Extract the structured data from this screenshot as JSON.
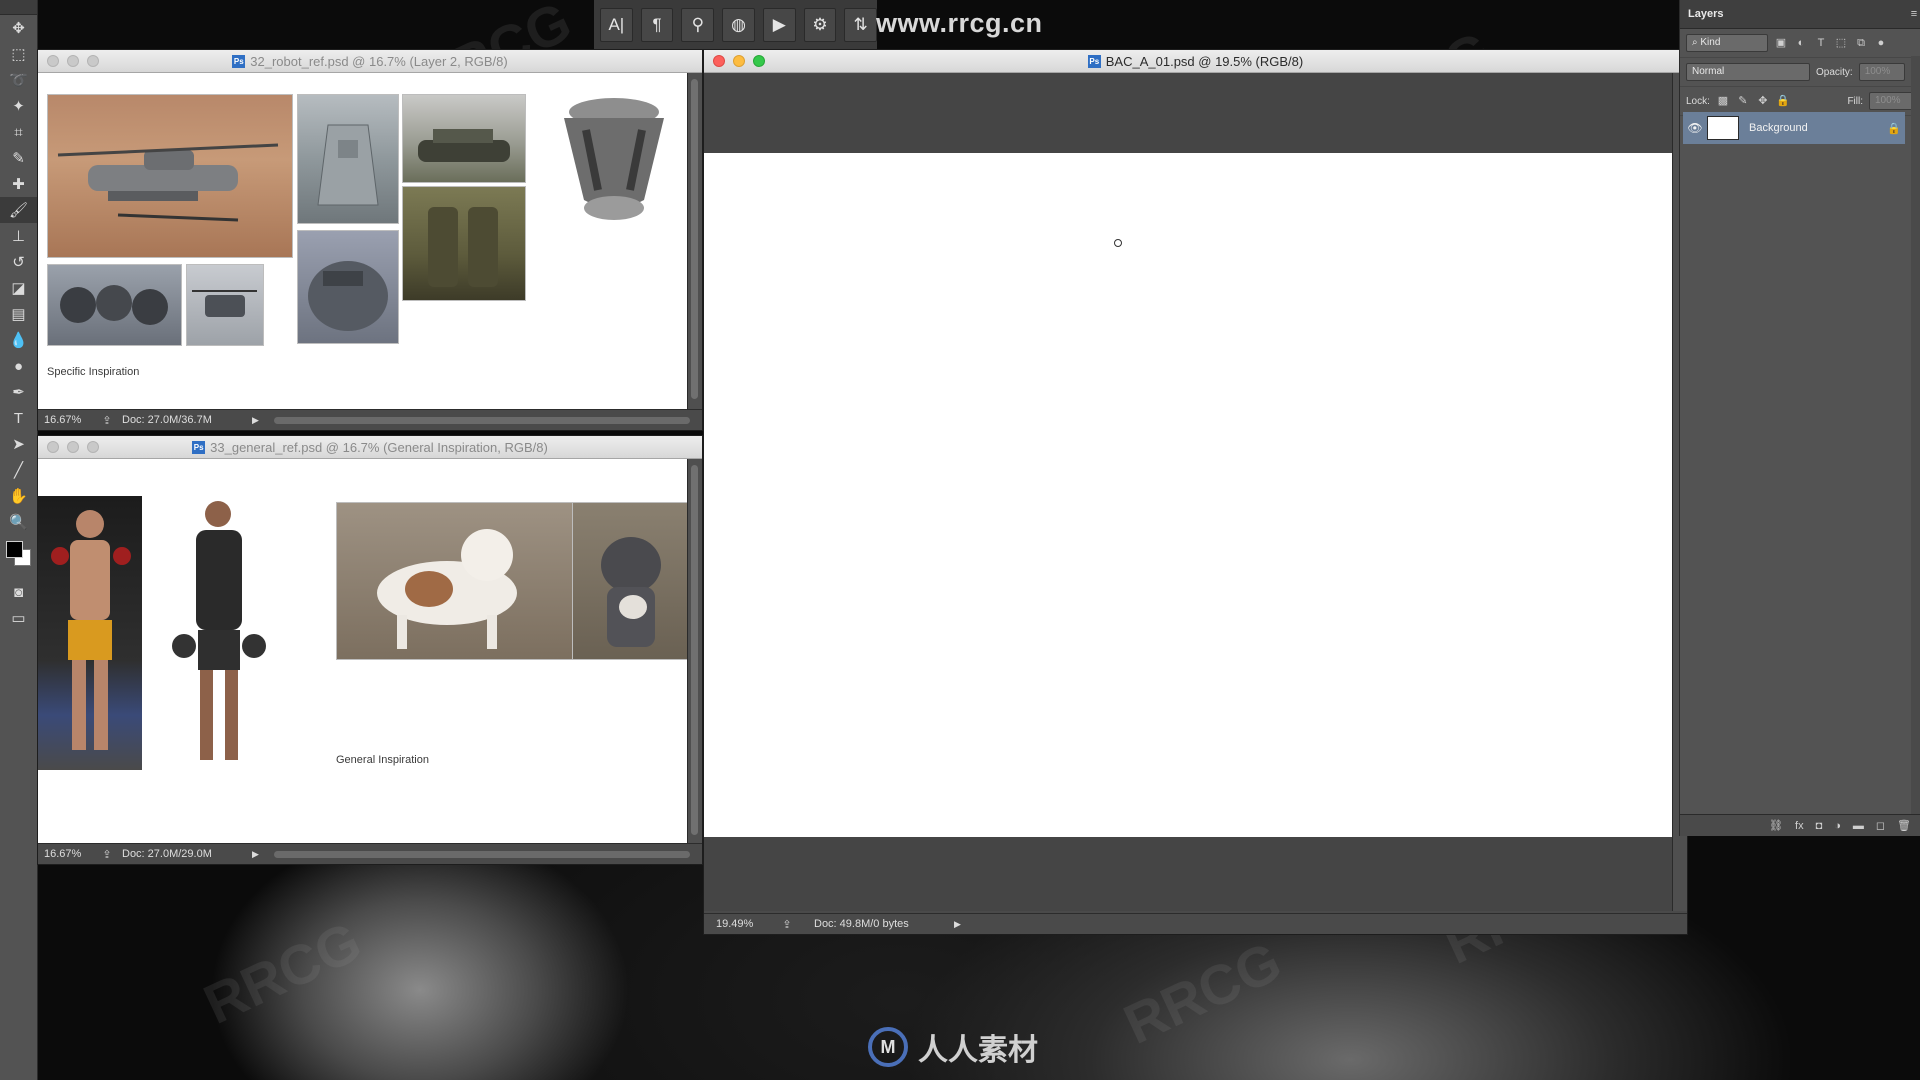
{
  "site_banner": "www.rrcg.cn",
  "watermark": "RRCG",
  "bottom_logo": "人人素材",
  "tools": [
    {
      "icon": "move-tool-icon",
      "glyph": "✥"
    },
    {
      "icon": "marquee-tool-icon",
      "glyph": "⬚"
    },
    {
      "icon": "lasso-tool-icon",
      "glyph": "➰"
    },
    {
      "icon": "magic-wand-tool-icon",
      "glyph": "✦"
    },
    {
      "icon": "crop-tool-icon",
      "glyph": "⌗"
    },
    {
      "icon": "eyedropper-tool-icon",
      "glyph": "✎"
    },
    {
      "icon": "healing-brush-tool-icon",
      "glyph": "✚"
    },
    {
      "icon": "brush-tool-icon",
      "glyph": "🖌"
    },
    {
      "icon": "clone-stamp-tool-icon",
      "glyph": "⊥"
    },
    {
      "icon": "history-brush-tool-icon",
      "glyph": "↺"
    },
    {
      "icon": "eraser-tool-icon",
      "glyph": "◪"
    },
    {
      "icon": "gradient-tool-icon",
      "glyph": "▤"
    },
    {
      "icon": "blur-tool-icon",
      "glyph": "💧"
    },
    {
      "icon": "dodge-tool-icon",
      "glyph": "●"
    },
    {
      "icon": "pen-tool-icon",
      "glyph": "✒"
    },
    {
      "icon": "type-tool-icon",
      "glyph": "T"
    },
    {
      "icon": "path-selection-tool-icon",
      "glyph": "➤"
    },
    {
      "icon": "line-tool-icon",
      "glyph": "╱"
    },
    {
      "icon": "hand-tool-icon",
      "glyph": "✋"
    },
    {
      "icon": "zoom-tool-icon",
      "glyph": "🔍"
    }
  ],
  "options_strip": [
    {
      "icon": "character-panel-icon",
      "glyph": "A|"
    },
    {
      "icon": "paragraph-panel-icon",
      "glyph": "¶"
    },
    {
      "icon": "brush-presets-icon",
      "glyph": "⚲"
    },
    {
      "icon": "clone-source-icon",
      "glyph": "◍"
    },
    {
      "icon": "actions-play-icon",
      "glyph": "▶"
    },
    {
      "icon": "tool-presets-icon",
      "glyph": "⚙"
    },
    {
      "icon": "brush-settings-icon",
      "glyph": "⇅"
    }
  ],
  "doc1": {
    "title": "32_robot_ref.psd @ 16.7% (Layer 2, RGB/8)",
    "caption": "Specific Inspiration",
    "zoom": "16.67%",
    "docinfo": "Doc: 27.0M/36.7M"
  },
  "doc2": {
    "title": "33_general_ref.psd @ 16.7% (General Inspiration, RGB/8)",
    "caption": "General Inspiration",
    "zoom": "16.67%",
    "docinfo": "Doc: 27.0M/29.0M"
  },
  "main_doc": {
    "title": "BAC_A_01.psd @ 19.5% (RGB/8)",
    "zoom": "19.49%",
    "docinfo": "Doc: 49.8M/0 bytes"
  },
  "layers": {
    "tab": "Layers",
    "kind_filter": "Kind",
    "blend_mode": "Normal",
    "opacity_label": "Opacity:",
    "opacity_value": "100%",
    "lock_label": "Lock:",
    "fill_label": "Fill:",
    "fill_value": "100%",
    "items": [
      {
        "name": "Background",
        "visible": true,
        "locked": true
      }
    ]
  }
}
